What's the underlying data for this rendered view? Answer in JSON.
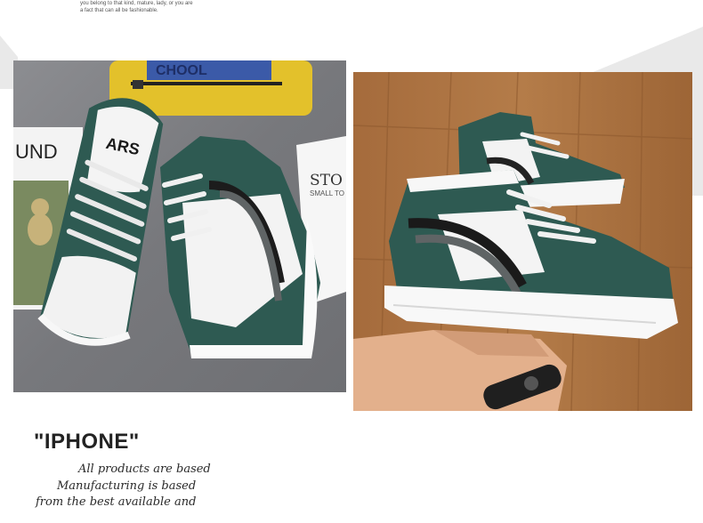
{
  "top_caption": {
    "line1": "you belong to that kind, mature, lady, or you are",
    "line2": "a fact that can all be fashionable."
  },
  "backpack_text": "CHOOL",
  "card_left_text": "UND",
  "card_right_text": "STO",
  "card_right_sub": "SMALL TO",
  "tongue_text": "ARS",
  "heading": "\"IPHONE\"",
  "script_lines": [
    "All products are based",
    "Manufacturing is based",
    "from the best  available and"
  ],
  "colors": {
    "shoe_green": "#2e5a52",
    "floor_wood": "#b07744",
    "cloth_grey": "#7d7e82",
    "backpack_yellow": "#e3c12b"
  }
}
